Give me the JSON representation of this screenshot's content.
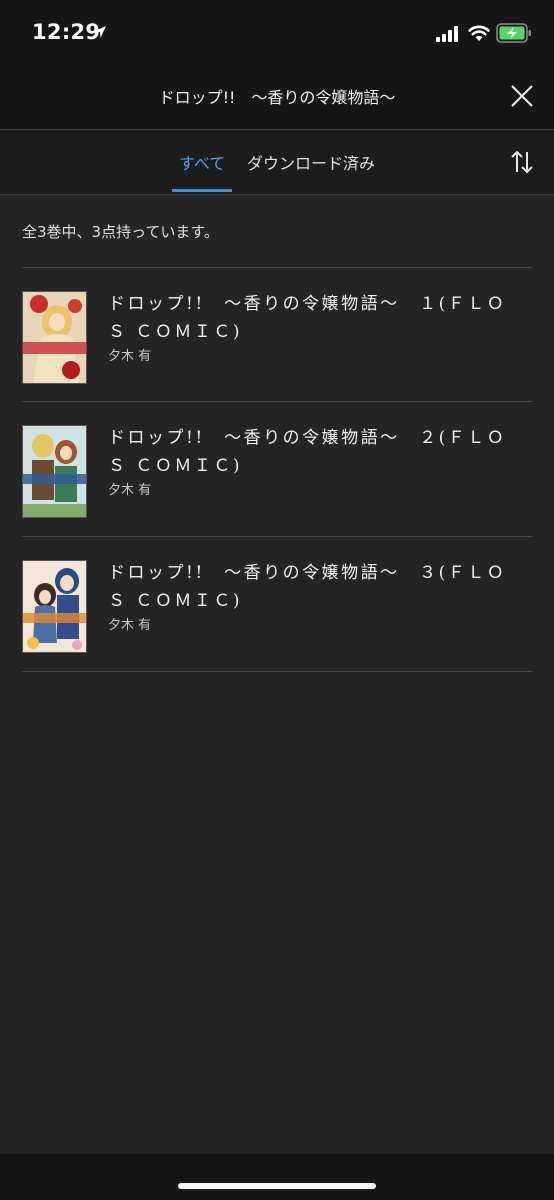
{
  "status_bar": {
    "time": "12:29"
  },
  "header": {
    "title": "ドロップ!!　〜香りの令嬢物語〜"
  },
  "tabs": [
    {
      "label": "すべて",
      "active": true
    },
    {
      "label": "ダウンロード済み",
      "active": false
    }
  ],
  "summary": {
    "count_text": "全3巻中、3点持っています。"
  },
  "books": [
    {
      "title": "ドロップ!!　〜香りの令嬢物語〜　１(ＦＬＯＳ ＣＯＭＩＣ)",
      "author": "夕木 有",
      "cover_color": "#d9b45a"
    },
    {
      "title": "ドロップ!!　〜香りの令嬢物語〜　２(ＦＬＯＳ ＣＯＭＩＣ)",
      "author": "夕木 有",
      "cover_color": "#6ea9b4"
    },
    {
      "title": "ドロップ!!　〜香りの令嬢物語〜　３(ＦＬＯＳ ＣＯＭＩＣ)",
      "author": "夕木 有",
      "cover_color": "#8aa0c8"
    }
  ],
  "colors": {
    "accent": "#3d8fd4",
    "background": "#242424",
    "header_bg": "#161616"
  }
}
